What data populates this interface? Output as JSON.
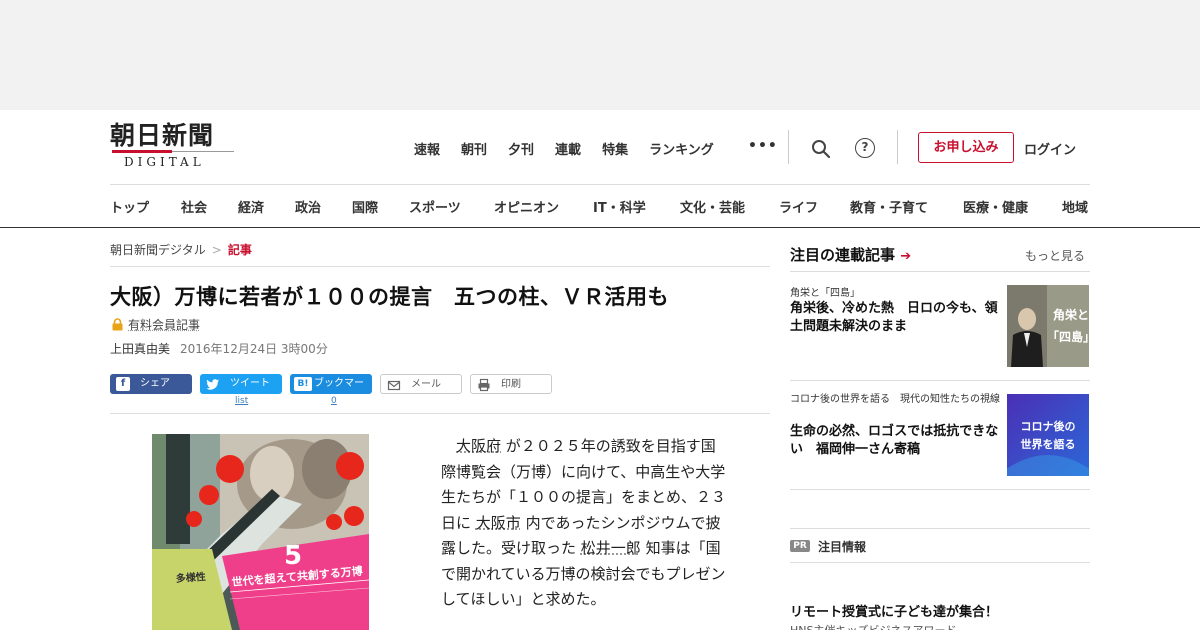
{
  "logo": {
    "kanji": "朝日新聞",
    "latin": "DIGITAL"
  },
  "topnav": [
    "速報",
    "朝刊",
    "夕刊",
    "連載",
    "特集",
    "ランキング"
  ],
  "more_dots": "•••",
  "help_glyph": "?",
  "apply_label": "お申し込み",
  "login_label": "ログイン",
  "categories": [
    "トップ",
    "社会",
    "経済",
    "政治",
    "国際",
    "スポーツ",
    "オピニオン",
    "IT・科学",
    "文化・芸能",
    "ライフ",
    "教育・子育て",
    "医療・健康",
    "地域"
  ],
  "breadcrumb": {
    "home": "朝日新聞デジタル",
    "sep": ">",
    "current": "記事"
  },
  "article": {
    "headline": "大阪）万博に若者が１００の提言　五つの柱、ＶＲ活用も",
    "paid_label": "有料会員記事",
    "author": "上田真由美",
    "date": "2016年12月24日 3時00分",
    "body": {
      "l1a": "大阪府",
      "l1b": "が２０２５年の誘致を目指す国",
      "l2": "際博覧会（万博）に向けて、中高生や大学",
      "l3": "生たちが「１００の提言」をまとめ、２３",
      "l4a": "日に",
      "l4b": "大阪市",
      "l4c": "内であったシンポジウムで披",
      "l5a": "露した。受け取った",
      "l5b": "松井一郎",
      "l5c": "知事は「国",
      "l6": "で開かれている万博の検討会でもプレゼン",
      "l7": "してほしい」と求めた。"
    },
    "photo_text": {
      "number": "5",
      "caption": "世代を超えて共創する万博",
      "side": "多様性"
    }
  },
  "share": {
    "facebook": {
      "icon": "f",
      "label": "シェア"
    },
    "twitter": {
      "icon": "t",
      "label": "ツイート",
      "count": "list"
    },
    "hatena": {
      "icon": "B!",
      "label": "ブックマーク",
      "count": "0"
    },
    "mail": {
      "label": "メール"
    },
    "print": {
      "label": "印刷"
    }
  },
  "sidebar": {
    "heading": "注目の連載記事",
    "arrow": "➔",
    "more": "もっと見る",
    "items": [
      {
        "kicker": "角栄と「四島」",
        "title": "角栄後、冷めた熱　日ロの今も、領土問題未解決のまま",
        "thumb_text_1": "角栄と",
        "thumb_text_2": "「四島」"
      },
      {
        "kicker": "コロナ後の世界を語る　現代の知性たちの視線",
        "title": "生命の必然、ロゴスでは抵抗できない　福岡伸一さん寄稿",
        "thumb_text_1": "コロナ後の",
        "thumb_text_2": "世界を語る"
      }
    ],
    "pr": {
      "badge": "PR",
      "label": "注目情報",
      "title": "リモート授賞式に子ども達が集合！",
      "sub": "HNS主催キッズビジネスアワード"
    }
  },
  "colors": {
    "brand": "#c8102e",
    "facebook": "#3b5998",
    "twitter": "#1da1f2",
    "hatena": "#1b8de0"
  }
}
